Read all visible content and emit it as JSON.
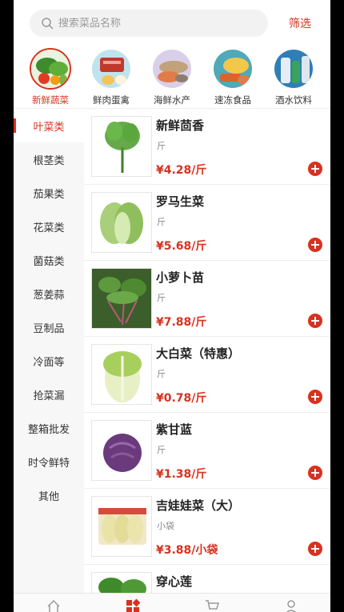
{
  "search": {
    "placeholder": "搜索菜品名称"
  },
  "filter_label": "筛选",
  "categories": [
    {
      "label": "新鲜蔬菜",
      "active": true
    },
    {
      "label": "鲜肉蛋禽",
      "active": false
    },
    {
      "label": "海鲜水产",
      "active": false
    },
    {
      "label": "速冻食品",
      "active": false
    },
    {
      "label": "酒水饮料",
      "active": false
    }
  ],
  "sidebar": {
    "items": [
      {
        "label": "叶菜类"
      },
      {
        "label": "根茎类"
      },
      {
        "label": "茄果类"
      },
      {
        "label": "花菜类"
      },
      {
        "label": "菌菇类"
      },
      {
        "label": "葱姜蒜"
      },
      {
        "label": "豆制品"
      },
      {
        "label": "冷面等"
      },
      {
        "label": "抢菜漏"
      },
      {
        "label": "整箱批发"
      },
      {
        "label": "时令鲜特"
      },
      {
        "label": "其他"
      }
    ]
  },
  "products": [
    {
      "name": "新鲜茴香",
      "unit": "斤",
      "price": "¥4.28/斤"
    },
    {
      "name": "罗马生菜",
      "unit": "斤",
      "price": "¥5.68/斤"
    },
    {
      "name": "小萝卜苗",
      "unit": "斤",
      "price": "¥7.88/斤"
    },
    {
      "name": "大白菜（特惠）",
      "unit": "斤",
      "price": "¥0.78/斤"
    },
    {
      "name": "紫甘蓝",
      "unit": "斤",
      "price": "¥1.38/斤"
    },
    {
      "name": "吉娃娃菜（大）",
      "unit": "小袋",
      "price": "¥3.88/小袋"
    },
    {
      "name": "穿心莲",
      "unit": "",
      "price": ""
    }
  ],
  "colors": {
    "accent": "#d7321f"
  },
  "tabs": [
    {
      "icon": "home-icon"
    },
    {
      "icon": "category-icon"
    },
    {
      "icon": "cart-icon"
    },
    {
      "icon": "user-icon"
    }
  ]
}
